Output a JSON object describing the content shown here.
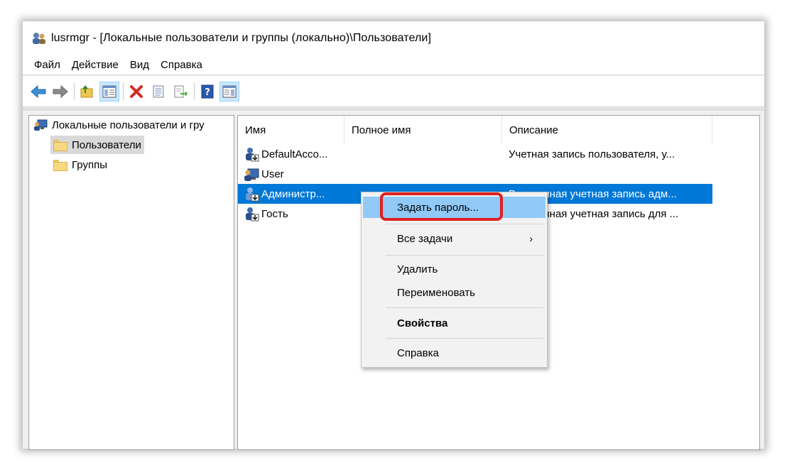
{
  "window": {
    "title": "lusrmgr - [Локальные пользователи и группы (локально)\\Пользователи]"
  },
  "menu": [
    "Файл",
    "Действие",
    "Вид",
    "Справка"
  ],
  "toolbar": {
    "buttons": [
      "back-icon",
      "forward-icon",
      "up-folder-icon",
      "show-hide-tree-icon",
      "delete-icon",
      "properties-icon",
      "export-list-icon",
      "help-icon",
      "action-pane-icon"
    ]
  },
  "tree": {
    "root": "Локальные пользователи и гру",
    "children": [
      "Пользователи",
      "Группы"
    ],
    "selected": "Пользователи"
  },
  "list": {
    "columns": [
      "Имя",
      "Полное имя",
      "Описание"
    ],
    "rows": [
      {
        "name": "DefaultAcco...",
        "full_name": "",
        "description": "Учетная запись пользователя, у..."
      },
      {
        "name": "User",
        "full_name": "",
        "description": ""
      },
      {
        "name": "Администр...",
        "full_name": "",
        "description": "Встроенная учетная запись адм..."
      },
      {
        "name": "Гость",
        "full_name": "",
        "description": "Встроенная учетная запись для ..."
      }
    ],
    "selected_row": "Администр..."
  },
  "context_menu": {
    "items": [
      "Задать пароль...",
      "Все задачи",
      "Удалить",
      "Переименовать",
      "Свойства",
      "Справка"
    ],
    "submenu_arrow": "›",
    "highlighted": "Задать пароль..."
  },
  "colors": {
    "selection": "#0078d7",
    "menu_hover": "#91c9f7",
    "callout": "#e02020"
  }
}
